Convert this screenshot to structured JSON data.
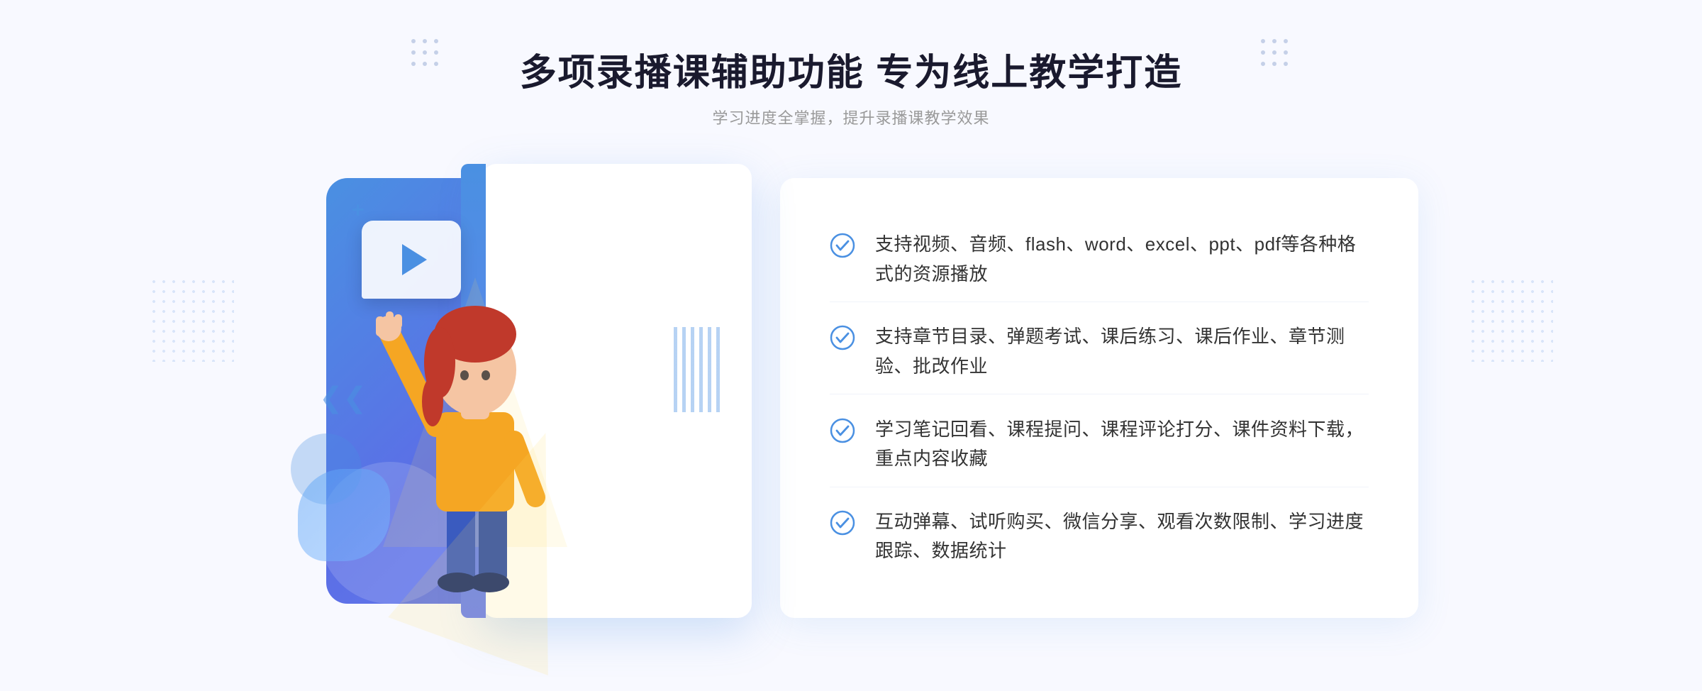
{
  "page": {
    "background": "#f5f7ff"
  },
  "header": {
    "title": "多项录播课辅助功能 专为线上教学打造",
    "subtitle": "学习进度全掌握，提升录播课教学效果"
  },
  "features": [
    {
      "id": 1,
      "text": "支持视频、音频、flash、word、excel、ppt、pdf等各种格式的资源播放"
    },
    {
      "id": 2,
      "text": "支持章节目录、弹题考试、课后练习、课后作业、章节测验、批改作业"
    },
    {
      "id": 3,
      "text": "学习笔记回看、课程提问、课程评论打分、课件资料下载，重点内容收藏"
    },
    {
      "id": 4,
      "text": "互动弹幕、试听购买、微信分享、观看次数限制、学习进度跟踪、数据统计"
    }
  ],
  "icons": {
    "check": "check-circle-icon",
    "nav_arrow": "chevron-left-icon"
  }
}
